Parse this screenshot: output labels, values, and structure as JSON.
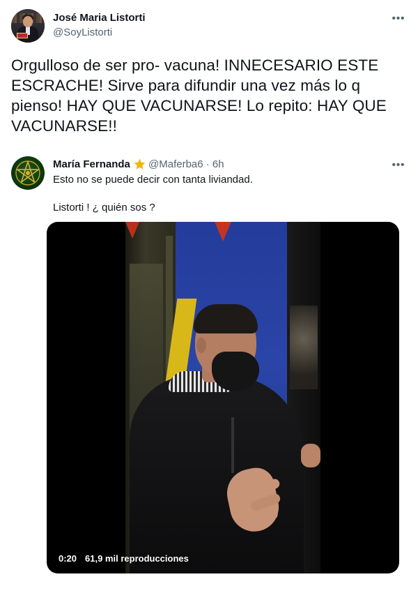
{
  "tweet": {
    "author_name": "José Maria Listorti",
    "author_handle": "@SoyListorti",
    "more_icon": "more-horizontal-icon",
    "more_glyph": "•••",
    "text": "Orgulloso de ser pro- vacuna! INNECESARIO ESTE ESCRACHE! Sirve para difundir una vez más lo q pienso! HAY QUE VACUNARSE! Lo repito: HAY QUE VACUNARSE!!"
  },
  "quoted_tweet": {
    "author_name": "María Fernanda",
    "badge_icon": "star-icon",
    "author_handle_time": "@Maferba6 · 6h",
    "more_glyph": "•••",
    "text_line1": "Esto no se puede decir con tanta liviandad.",
    "text_line2": "Listorti !  ¿ quién sos ?",
    "video": {
      "duration": "0:20",
      "views": "61,9 mil reproducciones"
    }
  },
  "colors": {
    "text": "#0f1419",
    "secondary_text": "#536471",
    "star": "#f4b400",
    "background": "#ffffff"
  }
}
